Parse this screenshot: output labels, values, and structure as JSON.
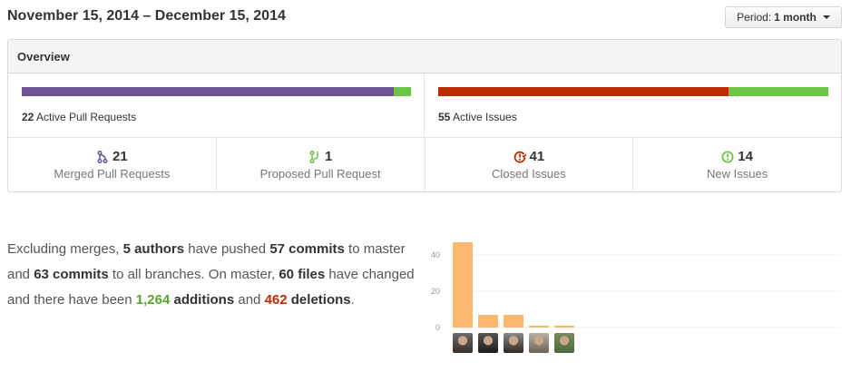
{
  "header": {
    "date_range": "November 15, 2014 – December 15, 2014",
    "period_prefix": "Period:",
    "period_value": "1 month"
  },
  "overview": {
    "title": "Overview",
    "pull_requests": {
      "count": "22",
      "label": "Active Pull Requests",
      "merged_fraction": 0.955,
      "colors": {
        "merged": "#6e5494",
        "proposed": "#6cc644"
      }
    },
    "issues": {
      "count": "55",
      "label": "Active Issues",
      "closed_fraction": 0.745,
      "colors": {
        "closed": "#bd2c00",
        "new": "#6cc644"
      }
    },
    "stats": [
      {
        "icon": "merge-icon",
        "count": "21",
        "label": "Merged Pull Requests",
        "color": "#6e5494"
      },
      {
        "icon": "pull-request-icon",
        "count": "1",
        "label": "Proposed Pull Request",
        "color": "#6cc644"
      },
      {
        "icon": "issue-closed-icon",
        "count": "41",
        "label": "Closed Issues",
        "color": "#bd2c00"
      },
      {
        "icon": "issue-opened-icon",
        "count": "14",
        "label": "New Issues",
        "color": "#6cc644"
      }
    ]
  },
  "summary": {
    "p1": "Excluding merges, ",
    "authors": "5 authors",
    "p2": " have pushed ",
    "commits_master": "57 commits",
    "p3": " to master and ",
    "commits_all": "63 commits",
    "p4": " to all branches. On master, ",
    "files": "60 files",
    "p5": " have changed and there have been ",
    "additions_num": "1,264",
    "additions_word": " additions",
    "p6": " and ",
    "deletions_num": "462",
    "deletions_word": "deletions",
    "p7": "."
  },
  "chart_data": {
    "type": "bar",
    "categories": [
      "author-1",
      "author-2",
      "author-3",
      "author-4",
      "author-5"
    ],
    "values": [
      47,
      7,
      7,
      1,
      1
    ],
    "ylim": [
      0,
      50
    ],
    "yticks": [
      "0",
      "20",
      "40"
    ],
    "bar_color": "#fdb870",
    "xlabel": "",
    "ylabel": ""
  }
}
